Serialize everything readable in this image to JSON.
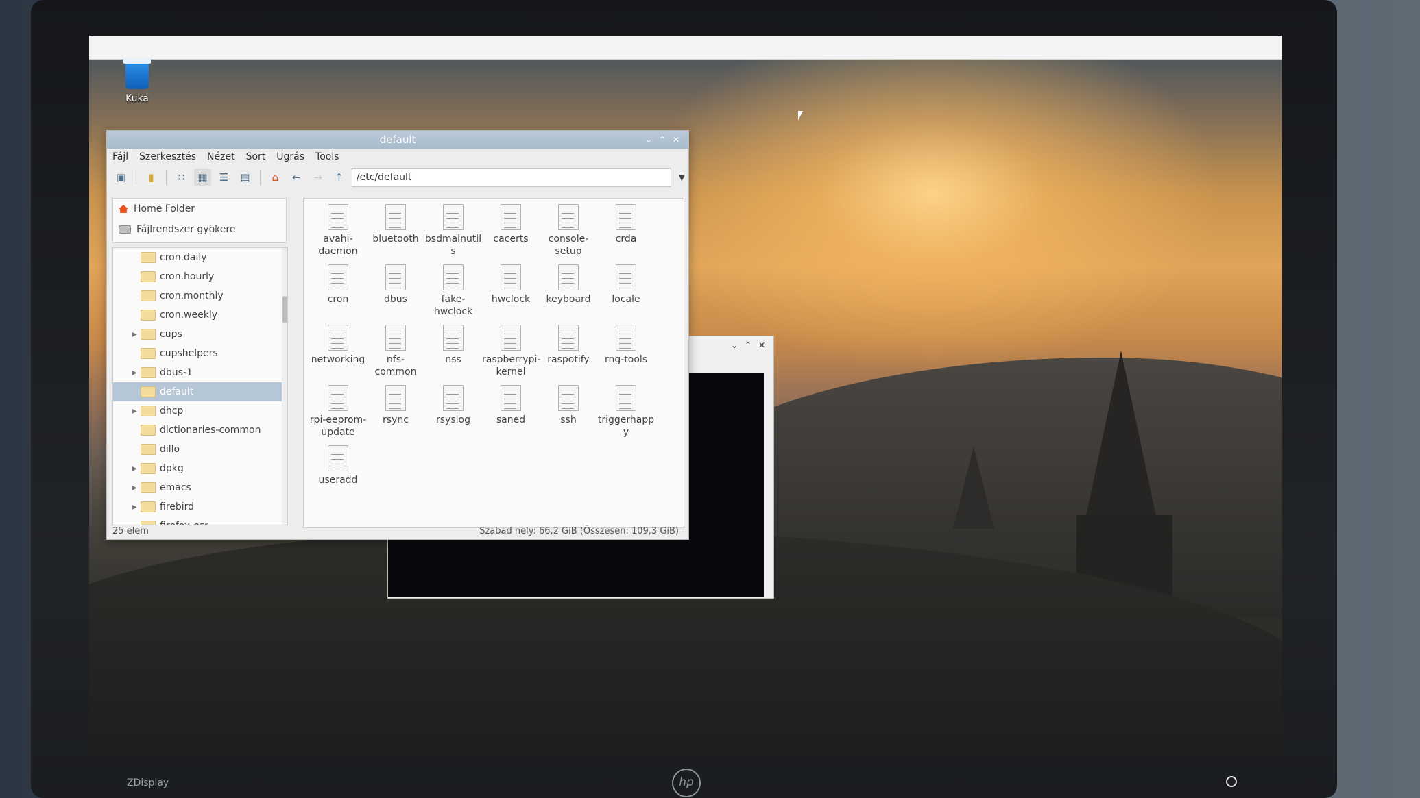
{
  "desktop": {
    "trash_label": "Kuka",
    "bezel_brand": "ZDisplay",
    "monitor_logo": "hp"
  },
  "file_manager": {
    "window_title": "default",
    "menu": [
      "Fájl",
      "Szerkesztés",
      "Nézet",
      "Sort",
      "Ugrás",
      "Tools"
    ],
    "path": "/etc/default",
    "places": [
      {
        "label": "Home Folder",
        "icon": "home-icon"
      },
      {
        "label": "Fájlrendszer gyökere",
        "icon": "drive-icon"
      }
    ],
    "tree": [
      {
        "label": "cron.daily",
        "expandable": false,
        "selected": false
      },
      {
        "label": "cron.hourly",
        "expandable": false,
        "selected": false
      },
      {
        "label": "cron.monthly",
        "expandable": false,
        "selected": false
      },
      {
        "label": "cron.weekly",
        "expandable": false,
        "selected": false
      },
      {
        "label": "cups",
        "expandable": true,
        "selected": false
      },
      {
        "label": "cupshelpers",
        "expandable": false,
        "selected": false
      },
      {
        "label": "dbus-1",
        "expandable": true,
        "selected": false
      },
      {
        "label": "default",
        "expandable": false,
        "selected": true
      },
      {
        "label": "dhcp",
        "expandable": true,
        "selected": false
      },
      {
        "label": "dictionaries-common",
        "expandable": false,
        "selected": false
      },
      {
        "label": "dillo",
        "expandable": false,
        "selected": false
      },
      {
        "label": "dpkg",
        "expandable": true,
        "selected": false
      },
      {
        "label": "emacs",
        "expandable": true,
        "selected": false
      },
      {
        "label": "firebird",
        "expandable": true,
        "selected": false
      },
      {
        "label": "firefox-esr",
        "expandable": false,
        "selected": false
      }
    ],
    "files": [
      "avahi-\ndaemon",
      "bluetooth",
      "bsdmainutil\ns",
      "cacerts",
      "console-\nsetup",
      "crda",
      "cron",
      "dbus",
      "fake-\nhwclock",
      "hwclock",
      "keyboard",
      "locale",
      "networking",
      "nfs-\ncommon",
      "nss",
      "raspberrypi-\nkernel",
      "raspotify",
      "rng-tools",
      "rpi-eeprom-\nupdate",
      "rsync",
      "rsyslog",
      "saned",
      "ssh",
      "triggerhapp\ny",
      "useradd"
    ],
    "status_left": "25 elem",
    "status_right": "Szabad hely: 66,2 GiB (Összesen: 109,3 GiB)"
  },
  "colors": {
    "titlebar": "#b0c2d3",
    "selection": "#b5c6d7",
    "folder": "#f4dc9c"
  }
}
